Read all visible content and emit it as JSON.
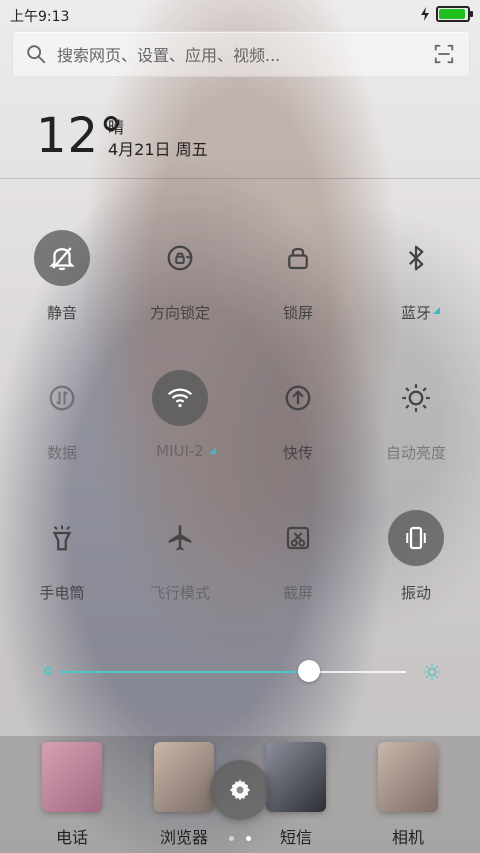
{
  "status_bar": {
    "time": "上午9:13",
    "battery_level": 0.92,
    "battery_color": "#21c021"
  },
  "search": {
    "placeholder": "搜索网页、设置、应用、视频..."
  },
  "weather": {
    "temperature": "12°",
    "condition": "晴",
    "date": "4月21日 周五"
  },
  "toggles": [
    {
      "label": "静音",
      "icon": "mute-bell-icon",
      "active": true
    },
    {
      "label": "方向锁定",
      "icon": "rotation-lock-icon",
      "active": false
    },
    {
      "label": "锁屏",
      "icon": "lock-icon",
      "active": false
    },
    {
      "label": "蓝牙",
      "icon": "bluetooth-icon",
      "active": false,
      "has_corner": true
    },
    {
      "label": "数据",
      "icon": "mobile-data-icon",
      "active": false
    },
    {
      "label": "MIUI-2",
      "icon": "wifi-icon",
      "active": true,
      "has_corner": true
    },
    {
      "label": "快传",
      "icon": "share-arrow-icon",
      "active": false
    },
    {
      "label": "自动亮度",
      "icon": "brightness-auto-icon",
      "active": false
    },
    {
      "label": "手电筒",
      "icon": "flashlight-icon",
      "active": false
    },
    {
      "label": "飞行模式",
      "icon": "airplane-icon",
      "active": false
    },
    {
      "label": "截屏",
      "icon": "screenshot-icon",
      "active": false
    },
    {
      "label": "振动",
      "icon": "vibrate-icon",
      "active": true
    }
  ],
  "brightness": {
    "level": 0.72,
    "accent": "#4cc6c6"
  },
  "dock": {
    "apps": [
      {
        "name": "电话"
      },
      {
        "name": "浏览器"
      },
      {
        "name": "短信"
      },
      {
        "name": "相机"
      }
    ]
  },
  "pager": {
    "pages": 2,
    "current": 2
  }
}
